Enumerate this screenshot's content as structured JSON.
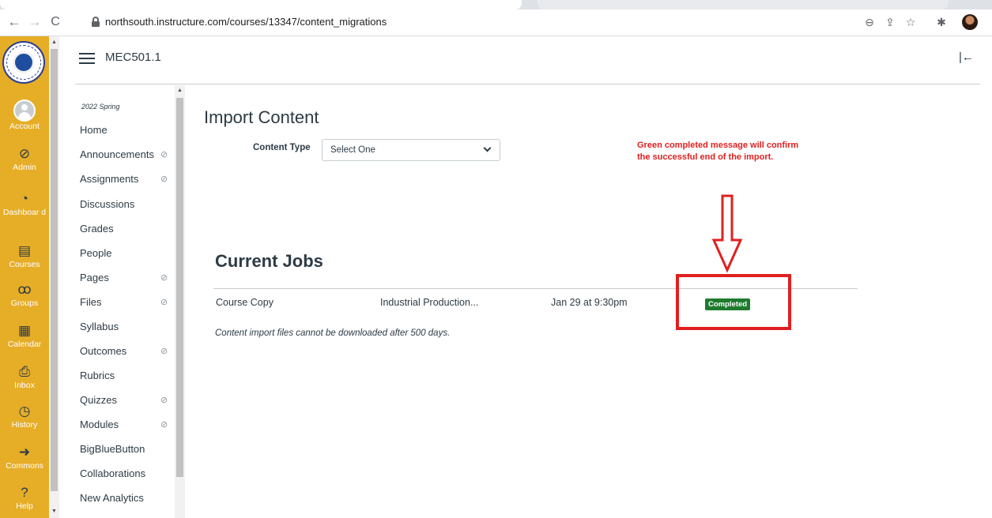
{
  "browser": {
    "url": "northsouth.instructure.com/courses/13347/content_migrations"
  },
  "global_nav": {
    "items": [
      {
        "label": "Account",
        "icon": "account-avatar-icon"
      },
      {
        "label": "Admin",
        "icon": "shield-icon"
      },
      {
        "label": "Dashboar d",
        "icon": "dashboard-gauge-icon"
      },
      {
        "label": "Courses",
        "icon": "book-icon"
      },
      {
        "label": "Groups",
        "icon": "groups-icon"
      },
      {
        "label": "Calendar",
        "icon": "calendar-icon"
      },
      {
        "label": "Inbox",
        "icon": "inbox-icon"
      },
      {
        "label": "History",
        "icon": "clock-icon"
      },
      {
        "label": "Commons",
        "icon": "commons-arrow-icon"
      },
      {
        "label": "Help",
        "icon": "help-icon"
      }
    ],
    "brand_color": "#e6ad27"
  },
  "header": {
    "breadcrumb": "MEC501.1"
  },
  "course_nav": {
    "term": "2022 Spring",
    "items": [
      {
        "label": "Home",
        "hidden": false
      },
      {
        "label": "Announcements",
        "hidden": true
      },
      {
        "label": "Assignments",
        "hidden": true
      },
      {
        "label": "Discussions",
        "hidden": false
      },
      {
        "label": "Grades",
        "hidden": false
      },
      {
        "label": "People",
        "hidden": false
      },
      {
        "label": "Pages",
        "hidden": true
      },
      {
        "label": "Files",
        "hidden": true
      },
      {
        "label": "Syllabus",
        "hidden": false
      },
      {
        "label": "Outcomes",
        "hidden": true
      },
      {
        "label": "Rubrics",
        "hidden": false
      },
      {
        "label": "Quizzes",
        "hidden": true
      },
      {
        "label": "Modules",
        "hidden": true
      },
      {
        "label": "BigBlueButton",
        "hidden": false
      },
      {
        "label": "Collaborations",
        "hidden": false
      },
      {
        "label": "New Analytics",
        "hidden": false
      }
    ]
  },
  "main": {
    "title": "Import Content",
    "content_type_label": "Content Type",
    "content_type_value": "Select One",
    "annotation": "Green completed message will confirm\nthe successful end of the import.",
    "jobs_title": "Current Jobs",
    "jobs": [
      {
        "type": "Course Copy",
        "source": "Industrial Production...",
        "date": "Jan 29 at 9:30pm",
        "status": "Completed"
      }
    ],
    "note": "Content import files cannot be downloaded after 500 days.",
    "colors": {
      "status_completed": "#1f7a2e",
      "annotation_red": "#e02020"
    }
  }
}
